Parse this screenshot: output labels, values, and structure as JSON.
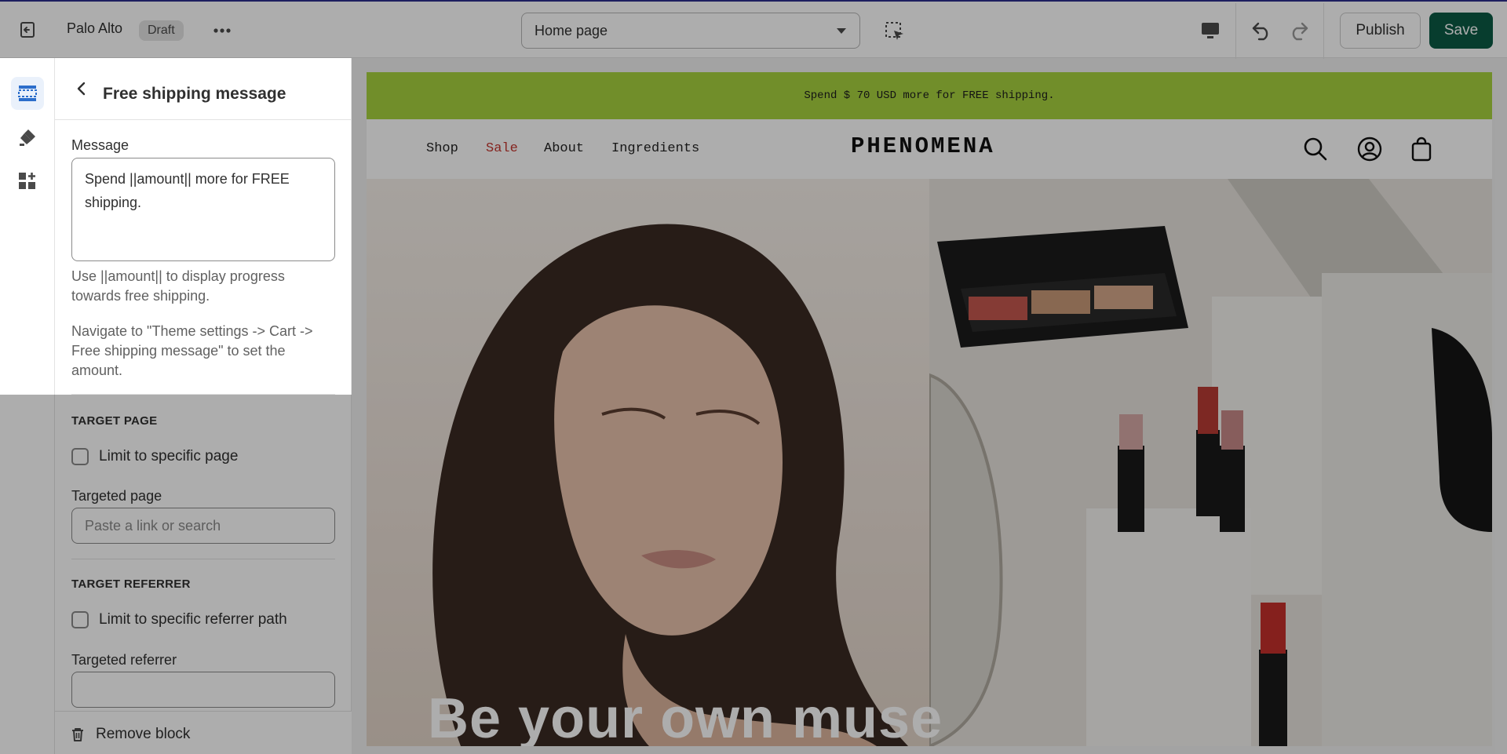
{
  "topbar": {
    "store_name": "Palo Alto",
    "status_badge": "Draft",
    "page_selector": "Home page",
    "publish_label": "Publish",
    "save_label": "Save"
  },
  "rail": {
    "items": [
      {
        "icon": "sections-icon",
        "active": true
      },
      {
        "icon": "theme-settings-brush-icon",
        "active": false
      },
      {
        "icon": "apps-icon",
        "active": false
      }
    ]
  },
  "panel": {
    "title": "Free shipping message",
    "message_label": "Message",
    "message_value": "Spend ||amount|| more for FREE shipping.",
    "help_1": "Use ||amount|| to display progress towards free shipping.",
    "help_2": "Navigate to \"Theme settings -> Cart -> Free shipping message\" to set the amount.",
    "target_page": {
      "heading": "TARGET PAGE",
      "checkbox_label": "Limit to specific page",
      "checked": false,
      "field_label": "Targeted page",
      "placeholder": "Paste a link or search"
    },
    "target_referrer": {
      "heading": "TARGET REFERRER",
      "checkbox_label": "Limit to specific referrer path",
      "checked": false,
      "field_label": "Targeted referrer",
      "value": ""
    },
    "remove_label": "Remove block"
  },
  "preview": {
    "announcement": "Spend $ 70 USD more for FREE shipping.",
    "nav": [
      "Shop",
      "Sale",
      "About",
      "Ingredients"
    ],
    "logo": "PHENOMENA",
    "header_icons": [
      "search-icon",
      "account-icon",
      "cart-bag-icon"
    ],
    "hero_headline": "Be your own muse",
    "colors": {
      "announcement_bg": "#a7d13f",
      "sale_link": "#c4362f",
      "save_button": "#0b5a45",
      "topbar_accent": "#2b2e8c"
    }
  }
}
